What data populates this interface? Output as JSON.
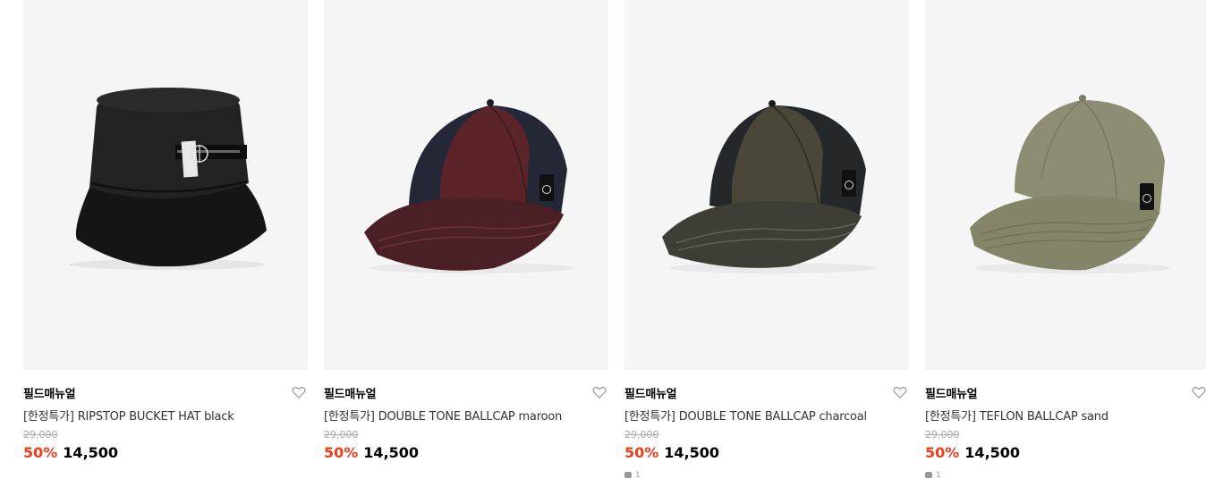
{
  "products": [
    {
      "brand": "필드매뉴얼",
      "title": "[한정특가] RIPSTOP BUCKET HAT black",
      "original_price": "29,000",
      "discount": "50%",
      "price": "14,500",
      "image_icon": "bucket-hat-image",
      "color": "#1c1c1c",
      "review_count": ""
    },
    {
      "brand": "필드매뉴얼",
      "title": "[한정특가] DOUBLE TONE BALLCAP maroon",
      "original_price": "29,000",
      "discount": "50%",
      "price": "14,500",
      "image_icon": "ballcap-image",
      "color": "#5a2428",
      "review_count": ""
    },
    {
      "brand": "필드매뉴얼",
      "title": "[한정특가] DOUBLE TONE BALLCAP charcoal",
      "original_price": "29,000",
      "discount": "50%",
      "price": "14,500",
      "image_icon": "ballcap-image",
      "color": "#3a3a34",
      "review_count": "1"
    },
    {
      "brand": "필드매뉴얼",
      "title": "[한정특가] TEFLON BALLCAP sand",
      "original_price": "29,000",
      "discount": "50%",
      "price": "14,500",
      "image_icon": "ballcap-image",
      "color": "#8e8c72",
      "review_count": "1"
    }
  ],
  "colors": {
    "discount": "#ef3e1b",
    "thumb_bg": "#f5f5f5"
  }
}
